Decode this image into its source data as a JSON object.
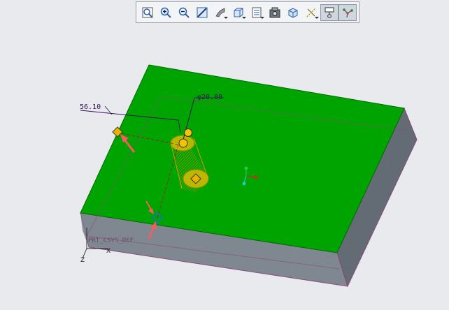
{
  "toolbar": {
    "buttons": [
      {
        "icon": "zoom-fit-icon"
      },
      {
        "icon": "zoom-in-icon"
      },
      {
        "icon": "zoom-out-icon"
      },
      {
        "icon": "repaint-icon"
      },
      {
        "icon": "view-orient-icon"
      },
      {
        "icon": "display-style-icon"
      },
      {
        "icon": "saved-views-icon"
      },
      {
        "icon": "view-manager-icon"
      },
      {
        "icon": "perspective-icon"
      },
      {
        "icon": "datum-display-icon"
      },
      {
        "icon": "annotation-display-icon",
        "active": true
      },
      {
        "icon": "spin-center-icon",
        "active": true
      }
    ]
  },
  "model": {
    "dim_horizontal": "56.10",
    "dim_diameter": "φ20.00",
    "csys_label": "PRT_CSYS_DEF",
    "axis_z": "Z",
    "axis_x": "X",
    "colors": {
      "top_face": "#00a400",
      "side_face": "#7f8790",
      "edge": "#8a4a7a",
      "handle": "#e8b400",
      "arrow": "#ff5a5a",
      "dimension": "#3a1060"
    }
  }
}
